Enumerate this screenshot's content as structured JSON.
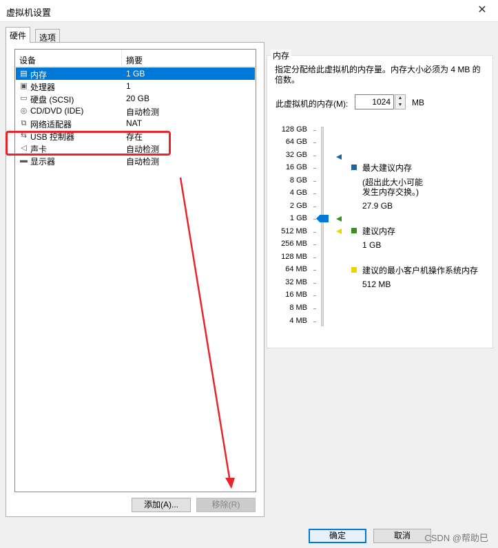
{
  "window": {
    "title": "虚拟机设置"
  },
  "tabs": [
    {
      "label": "硬件"
    },
    {
      "label": "选项"
    }
  ],
  "device_list": {
    "headers": {
      "device": "设备",
      "summary": "摘要"
    },
    "rows": [
      {
        "icon": "memory-icon",
        "name": "内存",
        "summary": "1 GB"
      },
      {
        "icon": "processor-icon",
        "name": "处理器",
        "summary": "1"
      },
      {
        "icon": "harddisk-icon",
        "name": "硬盘 (SCSI)",
        "summary": "20 GB"
      },
      {
        "icon": "cd-dvd-icon",
        "name": "CD/DVD (IDE)",
        "summary": "自动检测"
      },
      {
        "icon": "network-adapter-icon",
        "name": "网络适配器",
        "summary": "NAT"
      },
      {
        "icon": "usb-icon",
        "name": "USB 控制器",
        "summary": "存在"
      },
      {
        "icon": "speaker-icon",
        "name": "声卡",
        "summary": "自动检测"
      },
      {
        "icon": "monitor-icon",
        "name": "显示器",
        "summary": "自动检测"
      }
    ],
    "selected_index": 0
  },
  "list_buttons": {
    "add": "添加(A)...",
    "remove": "移除(R)"
  },
  "memory_panel": {
    "title": "内存",
    "description": "指定分配给此虚拟机的内存量。内存大小必须为 4 MB 的倍数。",
    "field_label": "此虚拟机的内存(M):",
    "value": "1024",
    "unit": "MB",
    "scale_labels": [
      "128 GB",
      "64 GB",
      "32 GB",
      "16 GB",
      "8 GB",
      "4 GB",
      "2 GB",
      "1 GB",
      "512 MB",
      "256 MB",
      "128 MB",
      "64 MB",
      "32 MB",
      "16 MB",
      "8 MB",
      "4 MB"
    ],
    "slider_value": "1 GB",
    "legend": [
      {
        "color": "#1e64a0",
        "title": "最大建议内存",
        "note_line1": "(超出此大小可能",
        "note_line2": "发生内存交换。)",
        "value": "27.9 GB"
      },
      {
        "color": "#3c8c1e",
        "title": "建议内存",
        "value": "1 GB"
      },
      {
        "color": "#f0d200",
        "title": "建议的最小客户机操作系统内存",
        "value": "512 MB"
      }
    ]
  },
  "dialog_buttons": {
    "ok": "确定",
    "cancel": "取消"
  },
  "watermark": "CSDN @帮助巳",
  "colors": {
    "selection": "#0078d7",
    "annotation": "#e8232a"
  }
}
